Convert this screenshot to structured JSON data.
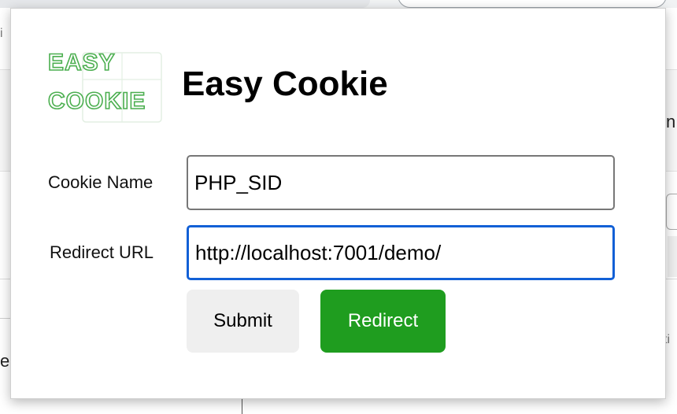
{
  "app": {
    "title": "Easy Cookie",
    "logo_line1": "EASY",
    "logo_line2": "COOKIE"
  },
  "form": {
    "cookie_name_label": "Cookie Name",
    "cookie_name_value": "PHP_SID",
    "redirect_url_label": "Redirect URL",
    "redirect_url_value": "http://localhost:7001/demo/"
  },
  "buttons": {
    "submit_label": "Submit",
    "redirect_label": "Redirect"
  },
  "background_fragments": {
    "left_top": "i",
    "left_mid": "e",
    "right_top": "n",
    "right_mid": "ti"
  },
  "colors": {
    "logo_green": "#4caf50",
    "redirect_button": "#1f9d1f",
    "focus_border": "#1260d6"
  }
}
